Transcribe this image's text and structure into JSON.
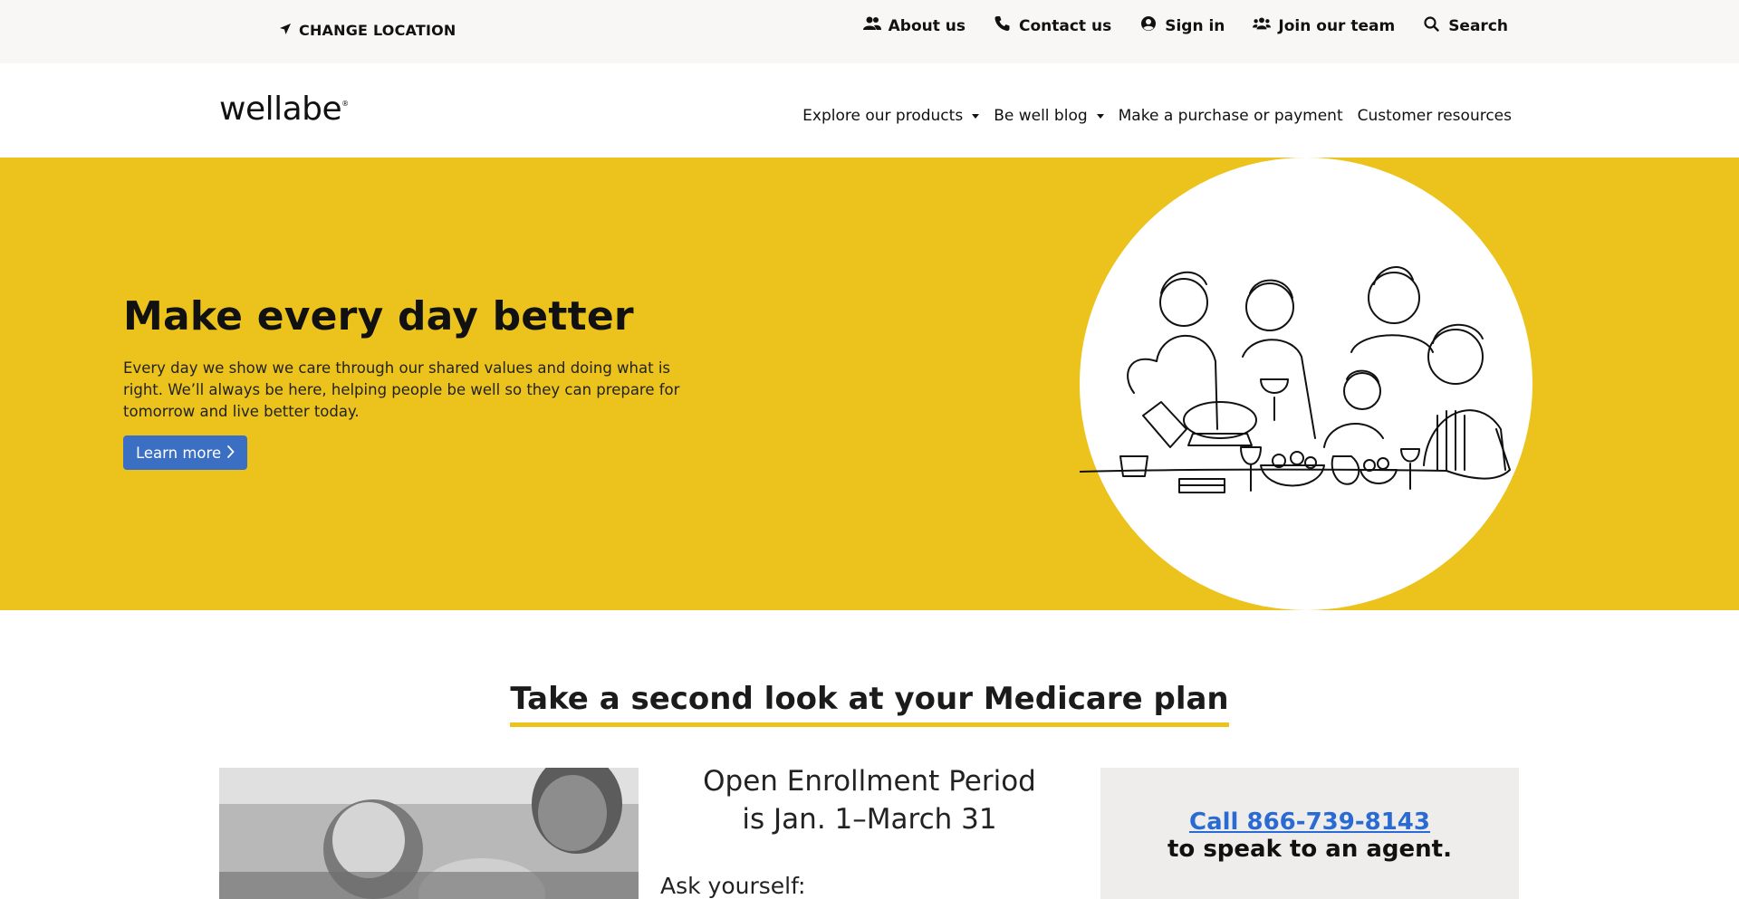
{
  "utility": {
    "change_location": "CHANGE LOCATION",
    "links": [
      {
        "label": "About us",
        "icon": "users-icon"
      },
      {
        "label": "Contact us",
        "icon": "phone-icon"
      },
      {
        "label": "Sign in",
        "icon": "user-circle-icon"
      },
      {
        "label": "Join our team",
        "icon": "team-icon"
      },
      {
        "label": "Search",
        "icon": "search-icon"
      }
    ]
  },
  "nav": {
    "logo": "wellabe",
    "items": [
      {
        "label": "Explore our products"
      },
      {
        "label": "Be well blog"
      },
      {
        "label": "Make a purchase or payment"
      },
      {
        "label": "Customer resources"
      }
    ]
  },
  "hero": {
    "title": "Make every day better",
    "body": "Every day we show we care through our shared values and doing what is right. We’ll always be here, helping people be well so they can prepare for tomorrow and live better today.",
    "cta": "Learn more",
    "background_color": "#ecc31c"
  },
  "medicare": {
    "title": "Take a second look at your Medicare plan",
    "oep_line1": "Open Enrollment Period",
    "oep_line2": "is Jan. 1–March 31",
    "ask": "Ask yourself:",
    "call_link": "Call 866-739-8143",
    "call_sub": "to speak to an agent."
  },
  "colors": {
    "accent_yellow": "#ecc31c",
    "button_blue": "#3a6fc4",
    "link_blue": "#2a6ad3"
  }
}
